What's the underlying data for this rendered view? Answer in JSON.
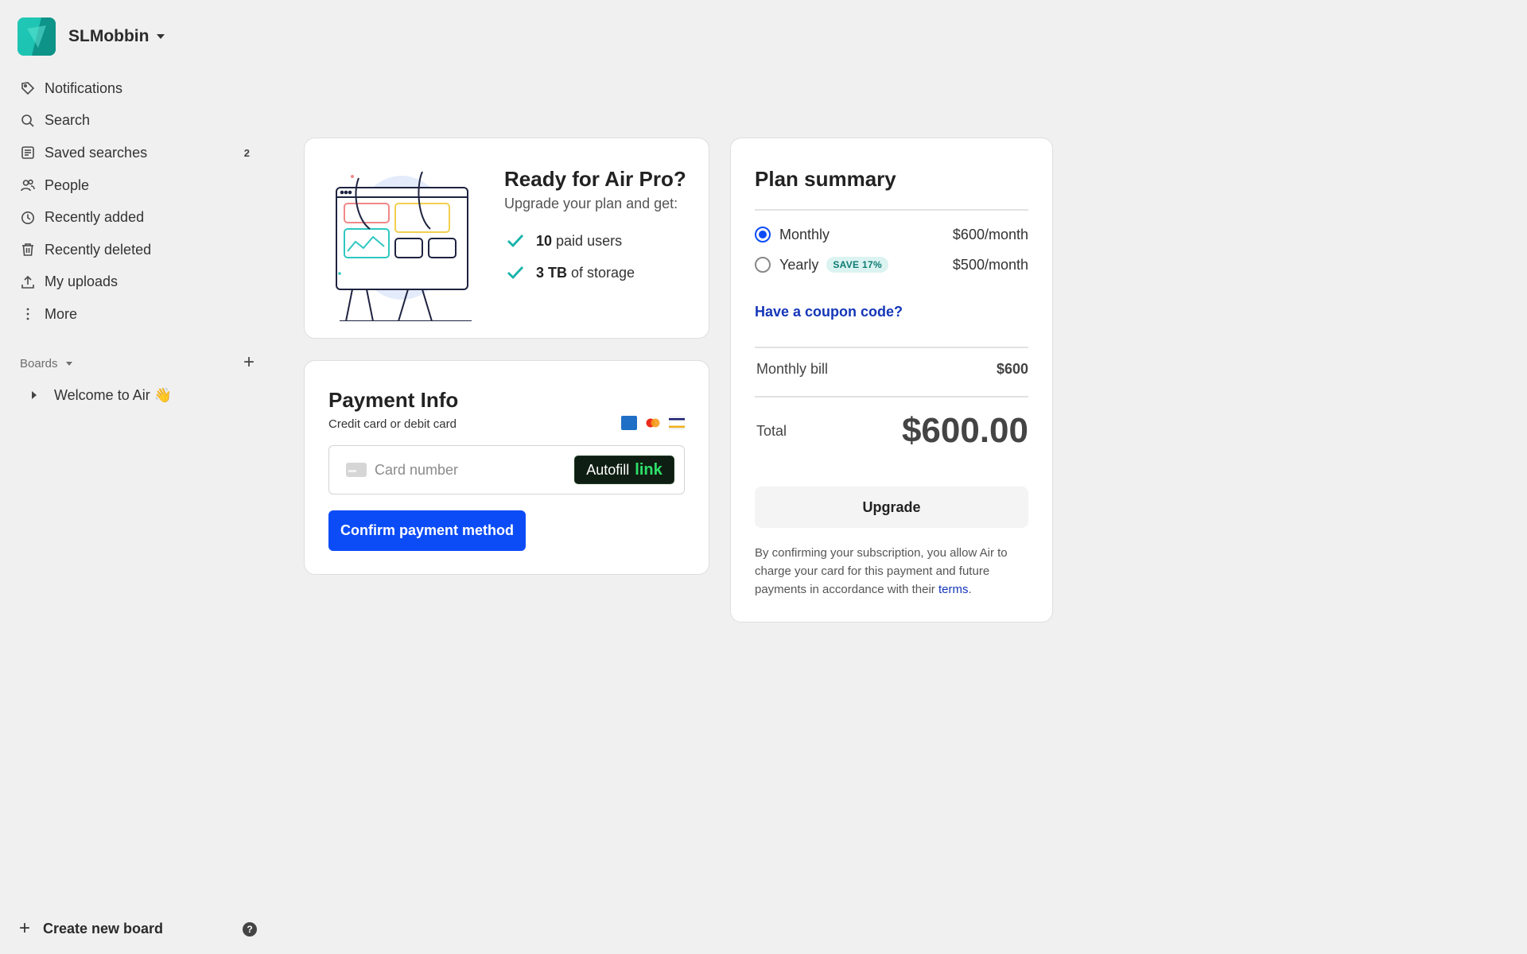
{
  "workspace": {
    "name": "SLMobbin"
  },
  "sidebar": {
    "items": [
      {
        "label": "Notifications",
        "icon": "tag-icon"
      },
      {
        "label": "Search",
        "icon": "search-icon"
      },
      {
        "label": "Saved searches",
        "icon": "saved-search-icon",
        "count": "2"
      },
      {
        "label": "People",
        "icon": "people-icon"
      },
      {
        "label": "Recently added",
        "icon": "clock-icon"
      },
      {
        "label": "Recently deleted",
        "icon": "trash-icon"
      },
      {
        "label": "My uploads",
        "icon": "upload-icon"
      },
      {
        "label": "More",
        "icon": "more-vertical-icon"
      }
    ],
    "boards_label": "Boards",
    "board_item": "Welcome to Air 👋",
    "create_board": "Create new board",
    "help": "?"
  },
  "promo": {
    "title": "Ready for Air Pro?",
    "subtitle": "Upgrade your plan and get:",
    "features": [
      {
        "bold": "10",
        "text": " paid users"
      },
      {
        "bold": "3 TB",
        "text": " of storage"
      }
    ],
    "accent": "#16b3a9"
  },
  "payment": {
    "title": "Payment Info",
    "subtitle": "Credit card or debit card",
    "brands": [
      "AMEX",
      "Mastercard",
      "VISA"
    ],
    "card_placeholder": "Card number",
    "autofill_label": "Autofill",
    "autofill_link": "link",
    "confirm_label": "Confirm payment method",
    "confirm_color": "#0c4cf7"
  },
  "summary": {
    "title": "Plan summary",
    "plans": [
      {
        "label": "Monthly",
        "price": "$600/month",
        "selected": true
      },
      {
        "label": "Yearly",
        "price": "$500/month",
        "badge": "SAVE 17%",
        "selected": false
      }
    ],
    "coupon": "Have a coupon code?",
    "bill_label": "Monthly bill",
    "bill_value": "$600",
    "total_label": "Total",
    "total_value": "$600.00",
    "upgrade_label": "Upgrade",
    "legal_text": "By confirming your subscription, you allow Air to charge your card for this payment and future payments in accordance with their ",
    "legal_link": "terms",
    "legal_end": "."
  }
}
